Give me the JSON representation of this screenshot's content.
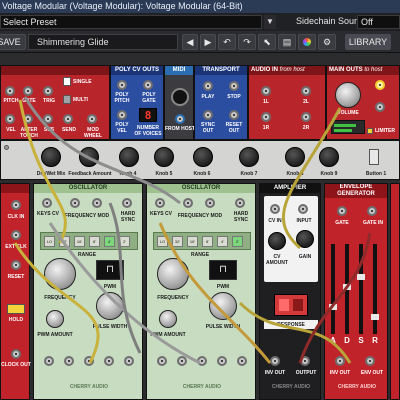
{
  "window": {
    "title": "Voltage Modular (Voltage Modular): Voltage Modular (64-Bit)"
  },
  "preset_bar": {
    "select_value": "Select Preset",
    "sidechain_label": "Sidechain Source:",
    "sidechain_value": "Off"
  },
  "toolbar": {
    "save_label": "SAVE",
    "preset_name": "Shimmering Glide",
    "library_label": "LIBRARY"
  },
  "modules": {
    "io_left": {
      "labels": [
        "PITCH",
        "GATE",
        "TRIG",
        "VEL",
        "AFTER TOUCH",
        "SUS",
        "SEND",
        "MOD WHEEL"
      ],
      "single": "SINGLE",
      "multi": "MULTI"
    },
    "poly_cv": {
      "title": "POLY CV OUTS",
      "poly_pitch": "POLY PITCH",
      "poly_gate": "POLY GATE",
      "poly_vel": "POLY VEL",
      "voices_label": "NUMBER OF VOICES",
      "voices_value": "8"
    },
    "midi": {
      "title": "MIDI",
      "from_host": "FROM HOST"
    },
    "transport": {
      "title": "TRANSPORT",
      "play": "PLAY",
      "stop": "STOP",
      "sync_out": "SYNC OUT",
      "reset_out": "RESET OUT"
    },
    "audio_in": {
      "title": "AUDIO IN",
      "subtitle": "from host",
      "labels": [
        "1L",
        "2L",
        "1R",
        "2R"
      ]
    },
    "main_outs": {
      "title": "MAIN OUTS",
      "subtitle": "to host",
      "volume": "VOLUME",
      "limiter": "LIMITER"
    },
    "knob_strip": {
      "labels": [
        "Dry/Wet Mix",
        "Feedback Amount",
        "Knob 4",
        "Knob 5",
        "Knob 6",
        "Knob 7",
        "Knob 8",
        "Knob 9",
        "Button 1"
      ]
    },
    "clock": {
      "labels": [
        "CLK IN",
        "EXT CLK",
        "RESET",
        "HOLD",
        "CLOCK OUT"
      ]
    },
    "oscillators": [
      {
        "title": "OSCILLATOR",
        "keys_cv": "KEYS CV",
        "freq_mod": "FREQUENCY MOD",
        "hard_sync": "HARD SYNC",
        "range_label": "RANGE",
        "range_values": [
          "LO",
          "32'",
          "16'",
          "8'",
          "4'",
          "2'"
        ],
        "frequency": "FREQUENCY",
        "pwm_amount": "PWM AMOUNT",
        "pwm": "PWM",
        "pulse_width": "PULSE WIDTH",
        "footer": "CHERRY AUDIO"
      },
      {
        "title": "OSCILLATOR",
        "keys_cv": "KEYS CV",
        "freq_mod": "FREQUENCY MOD",
        "hard_sync": "HARD SYNC",
        "range_label": "RANGE",
        "range_values": [
          "LO",
          "32'",
          "16'",
          "8'",
          "4'",
          "2'"
        ],
        "frequency": "FREQUENCY",
        "pwm_amount": "PWM AMOUNT",
        "pwm": "PWM",
        "pulse_width": "PULSE WIDTH",
        "footer": "CHERRY AUDIO"
      }
    ],
    "amplifier": {
      "title": "AMPLIFIER",
      "cv_in": "CV IN",
      "input": "INPUT",
      "cv_amount": "CV AMOUNT",
      "gain": "GAIN",
      "response": "RESPONSE",
      "inv_out": "INV OUT",
      "output": "OUTPUT",
      "footer": "CHERRY AUDIO"
    },
    "envelope": {
      "title": "ENVELOPE GENERATOR",
      "gate": "GATE",
      "gate_in": "GATE IN",
      "adsr": [
        "A",
        "D",
        "S",
        "R"
      ],
      "env_out": "ENV OUT",
      "inv_out": "INV OUT",
      "footer": "CHERRY AUDIO"
    }
  },
  "colors": {
    "title_bar": "#2b3a55",
    "rack_red": "#b8262c",
    "poly_blue": "#2c4ea1",
    "osc_green": "#c7dcc0",
    "env_red": "#c0232a",
    "amp_dark": "#1f1f21"
  },
  "icons": [
    "undo-icon",
    "redo-icon",
    "cursor-icon",
    "patch-icon",
    "color-wheel-icon",
    "gear-icon"
  ]
}
